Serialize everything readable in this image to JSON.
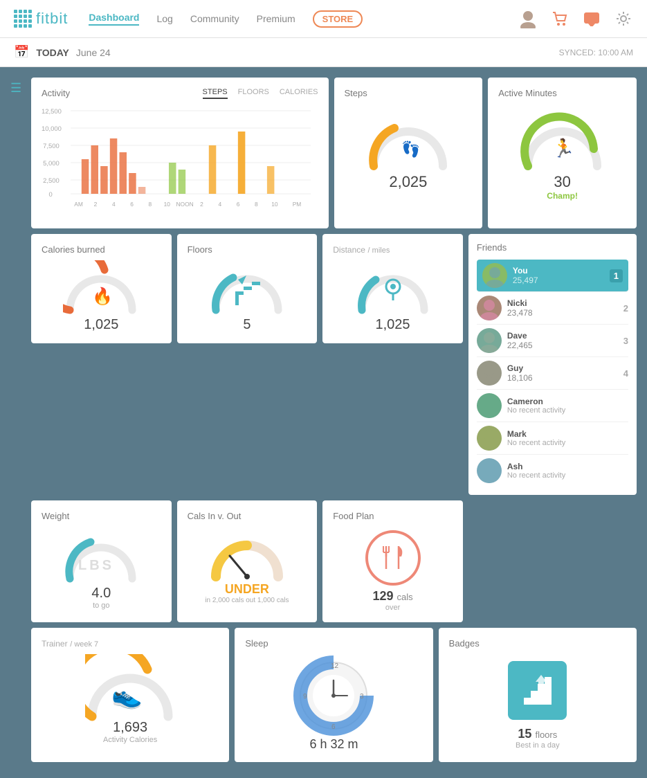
{
  "nav": {
    "logo_text": "fitbit",
    "links": [
      {
        "label": "Dashboard",
        "active": true
      },
      {
        "label": "Log",
        "active": false
      },
      {
        "label": "Community",
        "active": false
      },
      {
        "label": "Premium",
        "active": false
      }
    ],
    "store_label": "STORE"
  },
  "date_bar": {
    "today": "TODAY",
    "date": "June 24",
    "synced": "SYNCED: 10:00 AM"
  },
  "activity": {
    "title": "Activity",
    "tabs": [
      "STEPS",
      "FLOORS",
      "CALORIES"
    ],
    "active_tab": "STEPS",
    "y_labels": [
      "12,500",
      "10,000",
      "7,500",
      "5,000",
      "2,500",
      "0"
    ],
    "x_labels": [
      "AM",
      "2",
      "4",
      "6",
      "8",
      "10",
      "NOON",
      "2",
      "4",
      "6",
      "8",
      "10",
      "PM"
    ]
  },
  "steps": {
    "title": "Steps",
    "value": "2,025",
    "color": "#f5a623"
  },
  "active_minutes": {
    "title": "Active Minutes",
    "value": "30",
    "sub": "Champ!",
    "color": "#8dc63f"
  },
  "calories_burned": {
    "title": "Calories burned",
    "value": "1,025",
    "color": "#e86b3a"
  },
  "floors": {
    "title": "Floors",
    "value": "5",
    "color": "#4cb8c4"
  },
  "distance": {
    "title": "Distance",
    "unit": "/ miles",
    "value": "1,025",
    "color": "#4cb8c4"
  },
  "friends": {
    "title": "Friends",
    "list": [
      {
        "name": "You",
        "steps": "25,497",
        "rank": "1",
        "you": true
      },
      {
        "name": "Nicki",
        "steps": "23,478",
        "rank": "2",
        "you": false
      },
      {
        "name": "Dave",
        "steps": "22,465",
        "rank": "3",
        "you": false
      },
      {
        "name": "Guy",
        "steps": "18,106",
        "rank": "4",
        "you": false
      },
      {
        "name": "Cameron",
        "steps": "No recent activity",
        "rank": "",
        "you": false
      },
      {
        "name": "Mark",
        "steps": "No recent activity",
        "rank": "",
        "you": false
      },
      {
        "name": "Ash",
        "steps": "No recent activity",
        "rank": "",
        "you": false
      }
    ]
  },
  "weight": {
    "title": "Weight",
    "unit_label": "LBS",
    "value": "4.0",
    "sub": "to go",
    "color": "#4cb8c4"
  },
  "cals_in_out": {
    "title": "Cals In v. Out",
    "status": "UNDER",
    "in_label": "in 2,000 cals",
    "out_label": "out 1,000 cals"
  },
  "food_plan": {
    "title": "Food Plan",
    "value": "129",
    "unit": "cals",
    "sub": "over"
  },
  "trainer": {
    "title": "Trainer",
    "week": "/ week 7",
    "value": "1,693",
    "sub": "Activity Calories",
    "color": "#f5a623"
  },
  "sleep": {
    "title": "Sleep",
    "value": "6 h 32 m"
  },
  "badges": {
    "title": "Badges",
    "value": "15",
    "unit": "floors",
    "sub": "Best in a day"
  }
}
